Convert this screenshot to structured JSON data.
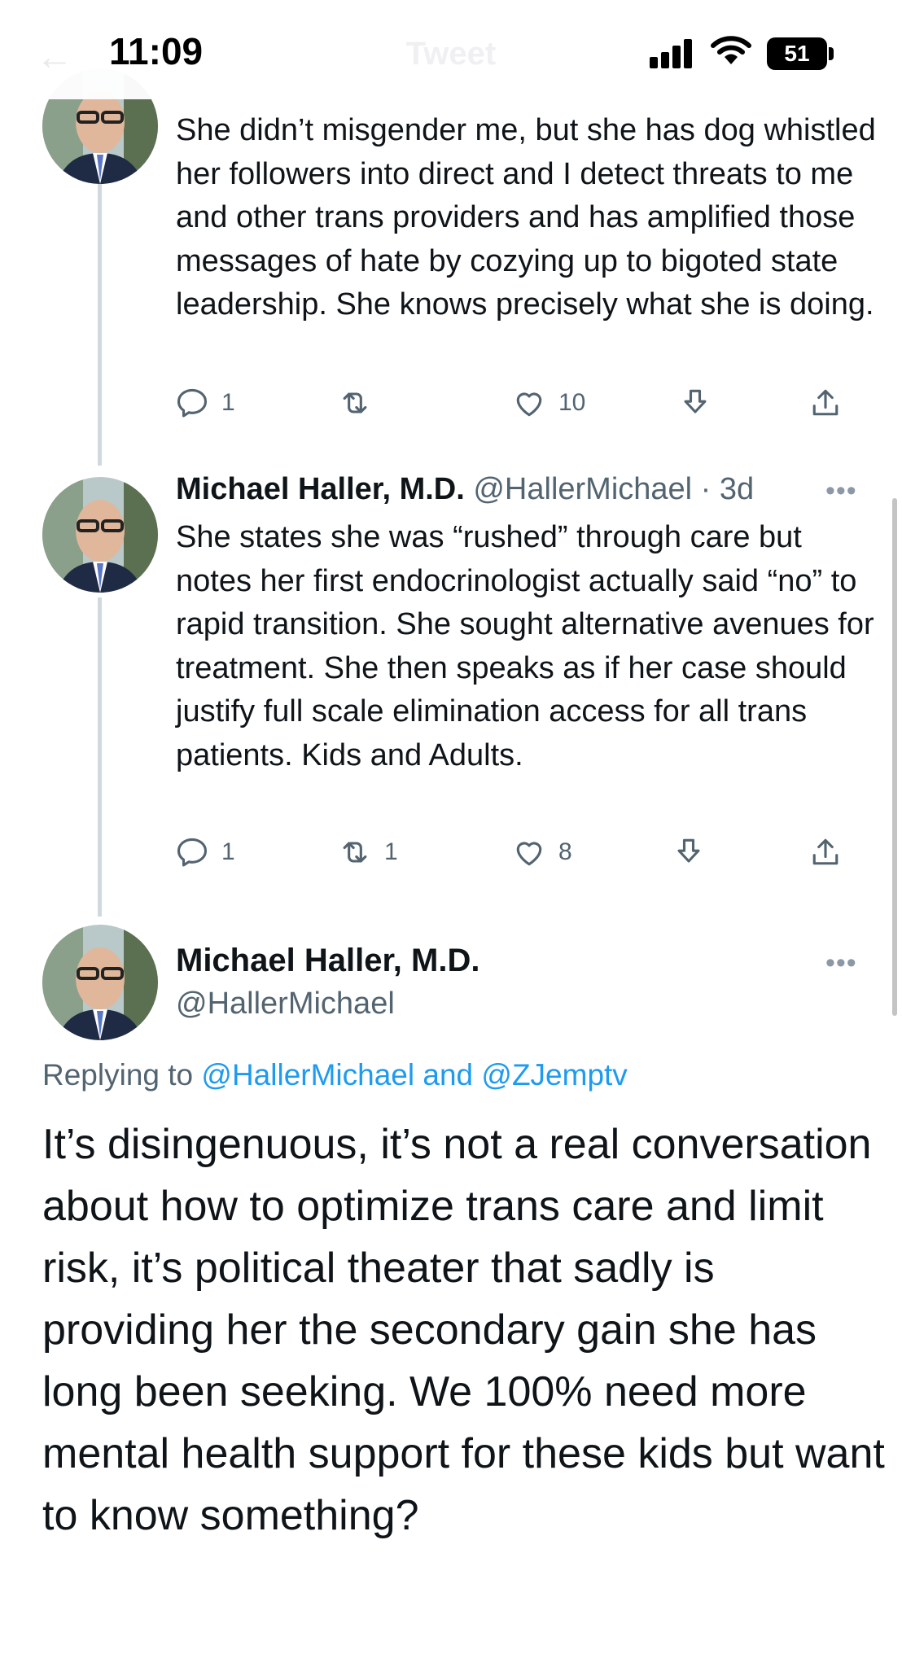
{
  "status_bar": {
    "time": "11:09",
    "battery": "51"
  },
  "header": {
    "title": "Tweet",
    "back_icon": "back-arrow-icon"
  },
  "tweets": [
    {
      "text": "She didn’t misgender me, but she has dog whistled her followers into direct and I detect threats to me and other trans providers  and has amplified those messages of hate by cozying up to bigoted state leadership. She knows precisely what she is doing.",
      "replies": "1",
      "retweets": "",
      "likes": "10"
    },
    {
      "name": "Michael Haller, M.D.",
      "handle_time": "@HallerMichael · 3d",
      "text": "She states she was “rushed” through care but notes her first endocrinologist actually said “no” to rapid transition. She sought alternative avenues for treatment. She then speaks as if her case should justify full scale elimination access for all trans patients. Kids and Adults.",
      "replies": "1",
      "retweets": "1",
      "likes": "8"
    }
  ],
  "main_tweet": {
    "name": "Michael Haller, M.D.",
    "handle": "@HallerMichael",
    "replying_prefix": "Replying to",
    "replying_user1": "@HallerMichael",
    "replying_and": "and",
    "replying_user2": "@ZJemptv",
    "text": "It’s disingenuous, it’s not a real conversation about how to optimize trans care and limit risk, it’s political theater that sadly is providing her the secondary gain she has long been seeking. We 100% need more mental health support for these kids but want to know something?",
    "more_label": "•••"
  },
  "colors": {
    "link": "#1d9bf0",
    "muted": "#536471",
    "text": "#0f1419"
  }
}
